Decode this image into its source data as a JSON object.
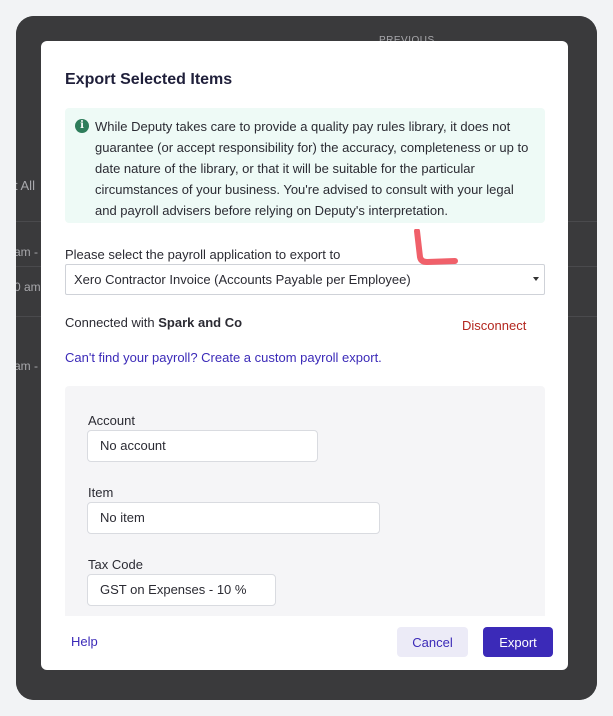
{
  "background": {
    "previous_label": "PREVIOUS",
    "select_all_fragment": "t All",
    "time_fragments": [
      "am -",
      "0 am -",
      "am -"
    ]
  },
  "modal": {
    "title": "Export Selected Items",
    "notice": "While Deputy takes care to provide a quality pay rules library, it does not guarantee (or accept responsibility for) the accuracy, completeness or up to date nature of the library, or that it will be suitable for the particular circumstances of your business. You're advised to consult with your legal and payroll advisers before relying on Deputy's interpretation.",
    "select_label": "Please select the payroll application to export to",
    "selected_application": "Xero Contractor Invoice (Accounts Payable per Employee)",
    "connected_prefix": "Connected with",
    "connected_org": "Spark and Co",
    "disconnect_label": "Disconnect",
    "custom_payroll_link": "Can't find your payroll? Create a custom payroll export.",
    "fields": [
      {
        "label": "Account",
        "value": "No account"
      },
      {
        "label": "Item",
        "value": "No item"
      },
      {
        "label": "Tax Code",
        "value": "GST on Expenses - 10 %"
      }
    ],
    "help_label": "Help",
    "cancel_label": "Cancel",
    "export_label": "Export"
  },
  "colors": {
    "primary": "#3b2ab8",
    "danger": "#b3261e",
    "notice_bg": "#eefaf6",
    "annotation": "#f0606a"
  }
}
